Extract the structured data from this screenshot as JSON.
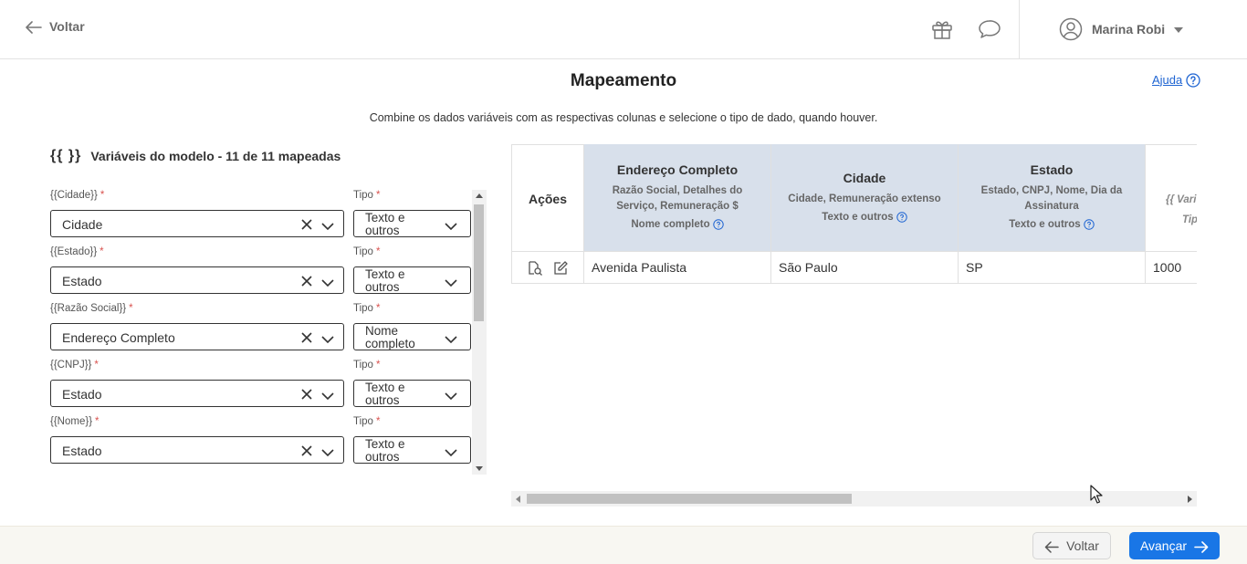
{
  "header": {
    "back_label": "Voltar",
    "user_name": "Marina Robi"
  },
  "page": {
    "title": "Mapeamento",
    "help_label": "Ajuda",
    "subtitle": "Combine os dados variáveis com as respectivas colunas e selecione o tipo de dado, quando houver."
  },
  "variables": {
    "braces": "{{ }}",
    "heading": "Variáveis do modelo - 11 de 11 mapeadas",
    "tipo_label": "Tipo",
    "required_mark": "*",
    "rows": [
      {
        "name": "{{Cidade}}",
        "mapped": "Cidade",
        "tipo": "Texto e outros"
      },
      {
        "name": "{{Estado}}",
        "mapped": "Estado",
        "tipo": "Texto e outros"
      },
      {
        "name": "{{Razão Social}}",
        "mapped": "Endereço Completo",
        "tipo": "Nome completo"
      },
      {
        "name": "{{CNPJ}}",
        "mapped": "Estado",
        "tipo": "Texto e outros"
      },
      {
        "name": "{{Nome}}",
        "mapped": "Estado",
        "tipo": "Texto e outros"
      }
    ]
  },
  "table": {
    "actions_header": "Ações",
    "columns": [
      {
        "title": "Endereço Completo",
        "desc": "Razão Social, Detalhes do Serviço, Remuneração $",
        "type": "Nome completo"
      },
      {
        "title": "Cidade",
        "desc": "Cidade, Remuneração extenso",
        "type": "Texto e outros"
      },
      {
        "title": "Estado",
        "desc": "Estado, CNPJ, Nome, Dia da Assinatura",
        "type": "Texto e outros"
      }
    ],
    "partial_col": {
      "desc": "{{ Vari",
      "type": "Tip",
      "value": "1000"
    },
    "row": [
      "Avenida Paulista",
      "São Paulo",
      "SP"
    ]
  },
  "footer": {
    "back_label": "Voltar",
    "next_label": "Avançar"
  },
  "colors": {
    "accent": "#1976e6",
    "link": "#1e64d2",
    "header_bg": "#d8e0eb",
    "required": "#d9534f"
  }
}
